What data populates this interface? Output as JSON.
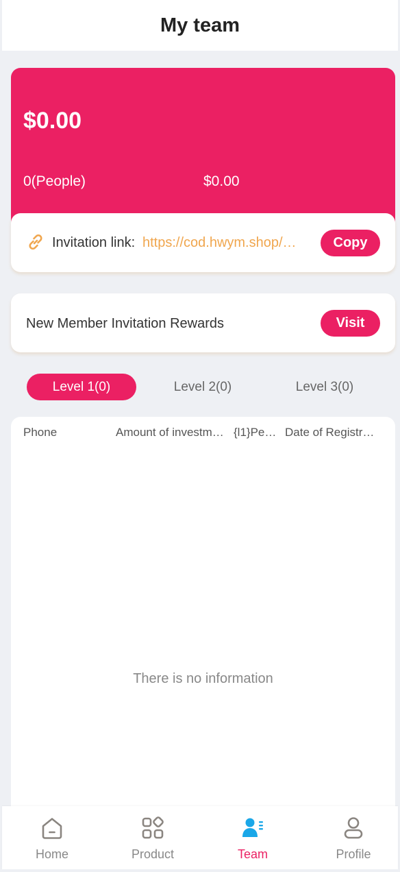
{
  "header": {
    "title": "My team"
  },
  "balance": {
    "total": "$0.00",
    "people": "0(People)",
    "income": "$0.00"
  },
  "invite": {
    "label": "Invitation link:",
    "url": "https://cod.hwym.shop/…",
    "copy_label": "Copy",
    "icon": "link-icon",
    "icon_color": "#f0a64e"
  },
  "reward": {
    "label": "New Member Invitation Rewards",
    "visit_label": "Visit"
  },
  "tabs": [
    {
      "label": "Level 1(0)",
      "active": true
    },
    {
      "label": "Level 2(0)",
      "active": false
    },
    {
      "label": "Level 3(0)",
      "active": false
    }
  ],
  "table": {
    "columns": [
      "Phone",
      "Amount of investm…",
      "{l1}Pe…",
      "Date of Registr…"
    ],
    "empty_text": "There is no information"
  },
  "nav": [
    {
      "label": "Home",
      "icon": "home-icon",
      "active": false
    },
    {
      "label": "Product",
      "icon": "grid-icon",
      "active": false
    },
    {
      "label": "Team",
      "icon": "team-icon",
      "active": true
    },
    {
      "label": "Profile",
      "icon": "user-icon",
      "active": false
    }
  ],
  "colors": {
    "accent": "#eb2063",
    "link": "#f0a64e",
    "team_icon": "#1aa7e8",
    "nav_icon": "#8a8580"
  }
}
